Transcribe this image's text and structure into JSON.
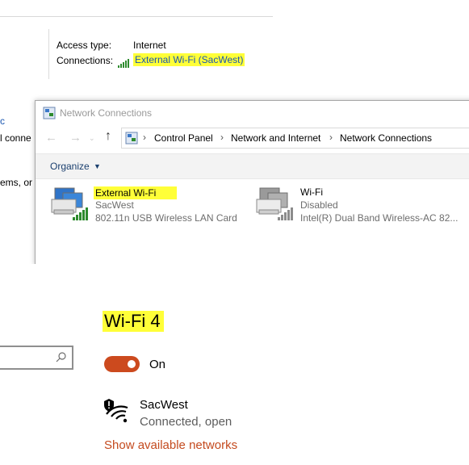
{
  "nsc": {
    "access_type_label": "Access type:",
    "access_type_value": "Internet",
    "connections_label": "Connections:",
    "connection_link": "External Wi-Fi (SacWest)"
  },
  "left_cut": {
    "line1": "c",
    "line2": "l conne",
    "line3": "ems, or g"
  },
  "network_connections": {
    "title": "Network Connections",
    "breadcrumb": [
      "Control Panel",
      "Network and Internet",
      "Network Connections"
    ],
    "organize_label": "Organize",
    "adapters": [
      {
        "name": "External Wi-Fi",
        "network": "SacWest",
        "device": "802.11n USB Wireless LAN Card"
      },
      {
        "name": "Wi-Fi",
        "network": "Disabled",
        "device": "Intel(R) Dual Band Wireless-AC 82..."
      }
    ]
  },
  "settings": {
    "heading": "Wi-Fi 4",
    "toggle_state": "On",
    "network_name": "SacWest",
    "network_status": "Connected, open",
    "show_networks_link": "Show available networks"
  },
  "colors": {
    "highlight": "#ffff38",
    "toggle_on": "#cc4a1e",
    "link_settings": "#c44a1e",
    "link_classic": "#1a56b0"
  },
  "icons": {
    "signal": "signal-bars-icon",
    "network_adapter": "network-adapter-icon",
    "wifi_shield": "wifi-shield-icon",
    "search": "search-icon"
  }
}
